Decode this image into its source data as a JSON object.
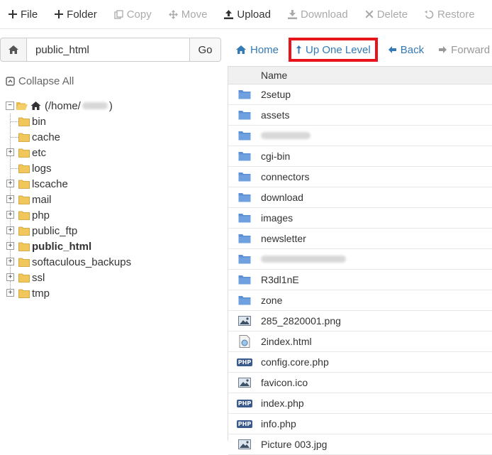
{
  "toolbar": {
    "buttons": [
      {
        "label": "File",
        "icon": "plus-icon",
        "enabled": true
      },
      {
        "label": "Folder",
        "icon": "plus-icon",
        "enabled": true
      },
      {
        "label": "Copy",
        "icon": "copy-icon",
        "enabled": false
      },
      {
        "label": "Move",
        "icon": "move-icon",
        "enabled": false
      },
      {
        "label": "Upload",
        "icon": "upload-icon",
        "enabled": true
      },
      {
        "label": "Download",
        "icon": "download-icon",
        "enabled": false
      },
      {
        "label": "Delete",
        "icon": "delete-icon",
        "enabled": false
      },
      {
        "label": "Restore",
        "icon": "restore-icon",
        "enabled": false
      }
    ]
  },
  "pathbar": {
    "value": "public_html",
    "go_label": "Go"
  },
  "nav": {
    "home": "Home",
    "up": "Up One Level",
    "back": "Back",
    "forward": "Forward"
  },
  "tree": {
    "collapse_label": "Collapse All",
    "root_label": "(/home/",
    "root_suffix": ")",
    "items": [
      {
        "label": "bin",
        "expandable": false,
        "bold": false
      },
      {
        "label": "cache",
        "expandable": false,
        "bold": false
      },
      {
        "label": "etc",
        "expandable": true,
        "bold": false
      },
      {
        "label": "logs",
        "expandable": false,
        "bold": false
      },
      {
        "label": "lscache",
        "expandable": true,
        "bold": false
      },
      {
        "label": "mail",
        "expandable": true,
        "bold": false
      },
      {
        "label": "php",
        "expandable": true,
        "bold": false
      },
      {
        "label": "public_ftp",
        "expandable": true,
        "bold": false
      },
      {
        "label": "public_html",
        "expandable": true,
        "bold": true
      },
      {
        "label": "softaculous_backups",
        "expandable": true,
        "bold": false
      },
      {
        "label": "ssl",
        "expandable": true,
        "bold": false
      },
      {
        "label": "tmp",
        "expandable": true,
        "bold": false
      }
    ]
  },
  "files": {
    "header": "Name",
    "rows": [
      {
        "name": "2setup",
        "type": "folder"
      },
      {
        "name": "assets",
        "type": "folder"
      },
      {
        "name": "",
        "type": "folder",
        "blurred": true,
        "blur_len": 0.35
      },
      {
        "name": "cgi-bin",
        "type": "folder"
      },
      {
        "name": "connectors",
        "type": "folder"
      },
      {
        "name": "download",
        "type": "folder"
      },
      {
        "name": "images",
        "type": "folder"
      },
      {
        "name": "newsletter",
        "type": "folder"
      },
      {
        "name": "",
        "type": "folder",
        "blurred": true,
        "blur_len": 0.6
      },
      {
        "name": "R3dl1nE",
        "type": "folder"
      },
      {
        "name": "zone",
        "type": "folder"
      },
      {
        "name": "285_2820001.png",
        "type": "image"
      },
      {
        "name": "2index.html",
        "type": "html"
      },
      {
        "name": "config.core.php",
        "type": "php"
      },
      {
        "name": "favicon.ico",
        "type": "image"
      },
      {
        "name": "index.php",
        "type": "php"
      },
      {
        "name": "info.php",
        "type": "php"
      },
      {
        "name": "Picture 003.jpg",
        "type": "image"
      }
    ]
  },
  "colors": {
    "accent": "#337ab7",
    "highlight": "#e8141c",
    "folder": "#5b8fd6",
    "tree_folder": "#e9b949"
  }
}
